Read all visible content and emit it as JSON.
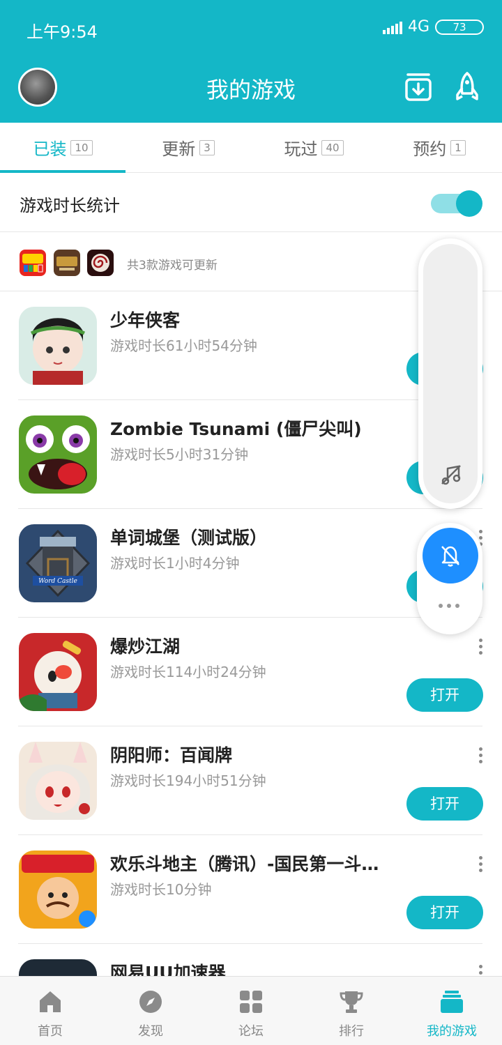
{
  "status_bar": {
    "time": "上午9:54",
    "network": "4G",
    "battery": "73"
  },
  "header": {
    "title": "我的游戏"
  },
  "tabs": [
    {
      "label": "已装",
      "count": "10",
      "active": true
    },
    {
      "label": "更新",
      "count": "3",
      "active": false
    },
    {
      "label": "玩过",
      "count": "40",
      "active": false
    },
    {
      "label": "预约",
      "count": "1",
      "active": false
    }
  ],
  "stats": {
    "label": "游戏时长统计",
    "enabled": true
  },
  "update_notice": {
    "text": "共3款游戏可更新"
  },
  "games": [
    {
      "name": "少年侠客",
      "playtime": "游戏时长61小时54分钟",
      "button": "打开"
    },
    {
      "name": "Zombie Tsunami (僵尸尖叫)",
      "playtime": "游戏时长5小时31分钟",
      "button": "打开"
    },
    {
      "name": "单词城堡（测试版）",
      "playtime": "游戏时长1小时4分钟",
      "button": "打开",
      "icon_text": "Word Castle"
    },
    {
      "name": "爆炒江湖",
      "playtime": "游戏时长114小时24分钟",
      "button": "打开"
    },
    {
      "name": "阴阳师：百闻牌",
      "playtime": "游戏时长194小时51分钟",
      "button": "打开"
    },
    {
      "name": "欢乐斗地主（腾讯）-国民第一斗…",
      "playtime": "游戏时长10分钟",
      "button": "打开"
    },
    {
      "name": "网易UU加速器",
      "playtime": "",
      "button": ""
    }
  ],
  "bottom_nav": [
    {
      "label": "首页",
      "icon": "home-icon",
      "active": false
    },
    {
      "label": "发现",
      "icon": "compass-icon",
      "active": false
    },
    {
      "label": "论坛",
      "icon": "grid-icon",
      "active": false
    },
    {
      "label": "排行",
      "icon": "trophy-icon",
      "active": false
    },
    {
      "label": "我的游戏",
      "icon": "stack-icon",
      "active": true
    }
  ],
  "colors": {
    "accent": "#14b7c7",
    "floating_bell": "#1e8fff"
  }
}
